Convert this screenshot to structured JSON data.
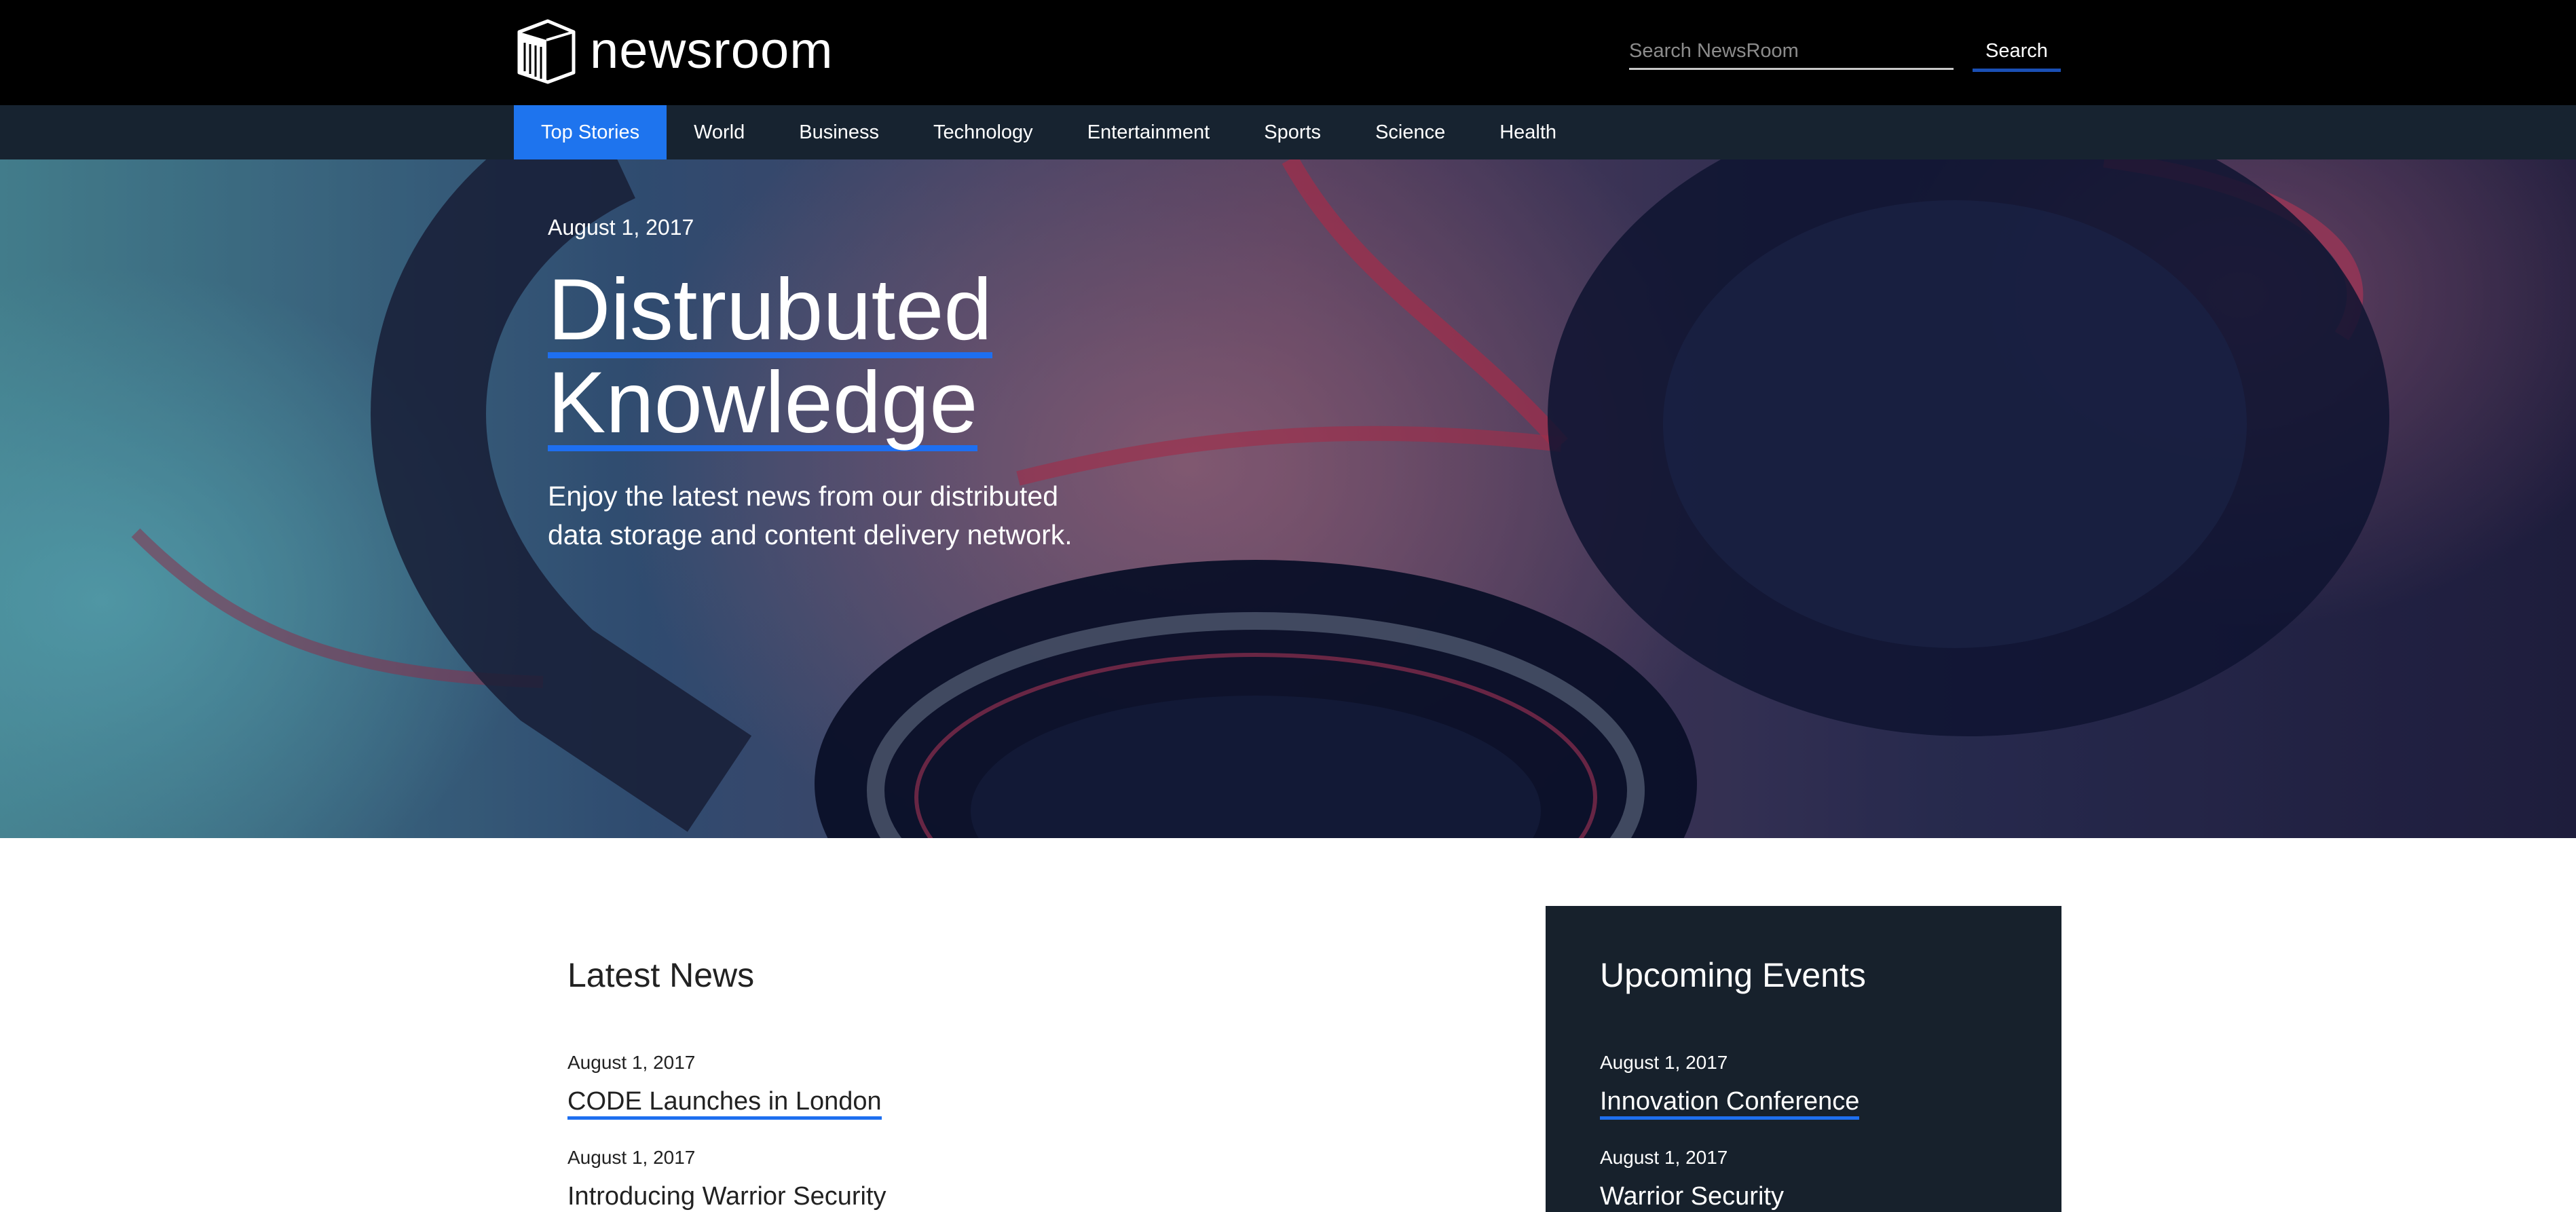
{
  "header": {
    "logo_text": "newsroom",
    "search_placeholder": "Search NewsRoom",
    "search_button": "Search"
  },
  "nav": {
    "items": [
      {
        "label": "Top Stories",
        "active": true
      },
      {
        "label": "World"
      },
      {
        "label": "Business"
      },
      {
        "label": "Technology"
      },
      {
        "label": "Entertainment"
      },
      {
        "label": "Sports"
      },
      {
        "label": "Science"
      },
      {
        "label": "Health"
      }
    ]
  },
  "hero": {
    "date": "August 1, 2017",
    "title_line1": "Distrubuted",
    "title_line2": "Knowledge",
    "subtitle": "Enjoy the latest news from our distributed data storage and content delivery network."
  },
  "latest": {
    "title": "Latest News",
    "items": [
      {
        "date": "August 1, 2017",
        "title": "CODE Launches in London"
      },
      {
        "date": "August 1, 2017",
        "title": "Introducing Warrior Security"
      }
    ]
  },
  "events": {
    "title": "Upcoming Events",
    "items": [
      {
        "date": "August 1, 2017",
        "title": "Innovation Conference"
      },
      {
        "date": "August 1, 2017",
        "title": "Warrior Security"
      }
    ]
  },
  "colors": {
    "accent": "#1e74ee",
    "header_bg": "#000000",
    "nav_bg": "#172330",
    "events_bg": "#17212c"
  }
}
